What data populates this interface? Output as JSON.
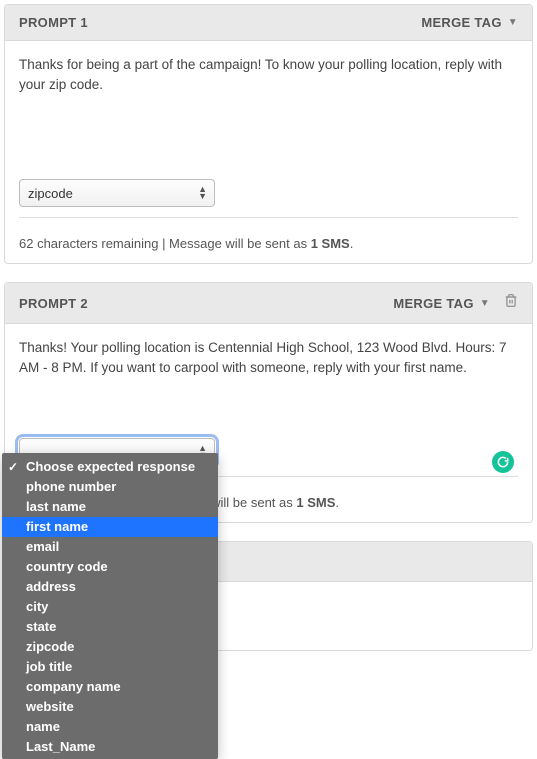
{
  "prompt1": {
    "title": "PROMPT 1",
    "merge_tag_label": "MERGE TAG",
    "message": "Thanks for being a part of the campaign! To know your polling location, reply with your zip code.",
    "select_value": "zipcode",
    "status_prefix": "62 characters remaining | Message will be sent as ",
    "status_bold": "1 SMS",
    "status_suffix": "."
  },
  "prompt2": {
    "title": "PROMPT 2",
    "merge_tag_label": "MERGE TAG",
    "message": "Thanks! Your polling location is Centennial High School, 123 Wood Blvd. Hours: 7 AM - 8 PM. If you want to carpool with someone, reply with your first name.",
    "status_mid": " will be sent as ",
    "status_bold": "1 SMS",
    "status_suffix": "."
  },
  "dropdown": {
    "items": [
      "Choose expected response",
      "phone number",
      "last name",
      "first name",
      "email",
      "country code",
      "address",
      "city",
      "state",
      "zipcode",
      "job title",
      "company name",
      "website",
      "name",
      "Last_Name"
    ],
    "checked_index": 0,
    "highlighted_index": 3
  }
}
